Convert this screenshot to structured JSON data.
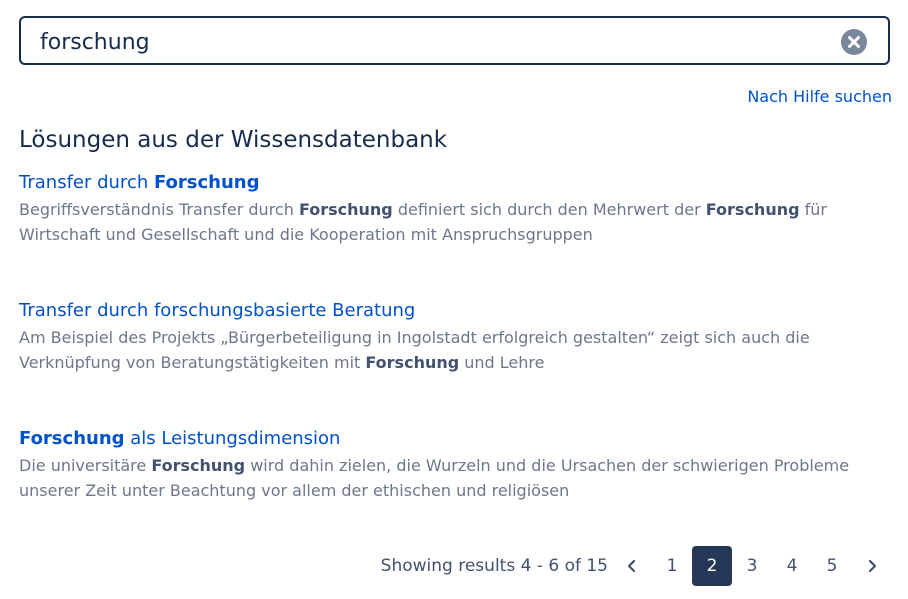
{
  "search": {
    "value": "forschung"
  },
  "help_link": "Nach Hilfe suchen",
  "section_title": "Lösungen aus der Wissensdatenbank",
  "results": [
    {
      "title_parts": [
        {
          "text": "Transfer durch ",
          "bold": false
        },
        {
          "text": "Forschung",
          "bold": true
        }
      ],
      "excerpt_parts": [
        {
          "text": "Begriffsverständnis Transfer durch ",
          "bold": false
        },
        {
          "text": "Forschung",
          "bold": true
        },
        {
          "text": " definiert sich durch den Mehrwert der ",
          "bold": false
        },
        {
          "text": "Forschung",
          "bold": true
        },
        {
          "text": " für Wirtschaft und Gesellschaft und die Kooperation mit Anspruchsgruppen",
          "bold": false
        }
      ]
    },
    {
      "title_parts": [
        {
          "text": "Transfer durch forschungsbasierte Beratung",
          "bold": false
        }
      ],
      "excerpt_parts": [
        {
          "text": "Am Beispiel des Projekts „Bürgerbeteiligung in Ingolstadt erfolgreich gestalten“ zeigt sich auch die Verknüpfung von Beratungstätigkeiten mit ",
          "bold": false
        },
        {
          "text": "Forschung",
          "bold": true
        },
        {
          "text": " und Lehre",
          "bold": false
        }
      ]
    },
    {
      "title_parts": [
        {
          "text": "Forschung",
          "bold": true
        },
        {
          "text": " als Leistungsdimension",
          "bold": false
        }
      ],
      "excerpt_parts": [
        {
          "text": "Die universitäre ",
          "bold": false
        },
        {
          "text": "Forschung",
          "bold": true
        },
        {
          "text": " wird dahin zielen, die Wurzeln und die Ursachen der schwierigen Probleme unserer Zeit unter Beachtung vor allem der ethischen und religiösen",
          "bold": false
        }
      ]
    }
  ],
  "pagination": {
    "showing_text": "Showing results 4 - 6 of 15",
    "pages": [
      "1",
      "2",
      "3",
      "4",
      "5"
    ],
    "current_page": "2",
    "prev_icon": "chevron-left-icon",
    "next_icon": "chevron-right-icon"
  },
  "colors": {
    "link": "#0052cc",
    "text": "#172b4d",
    "muted": "#6b778c",
    "active_page_bg": "#253858"
  }
}
